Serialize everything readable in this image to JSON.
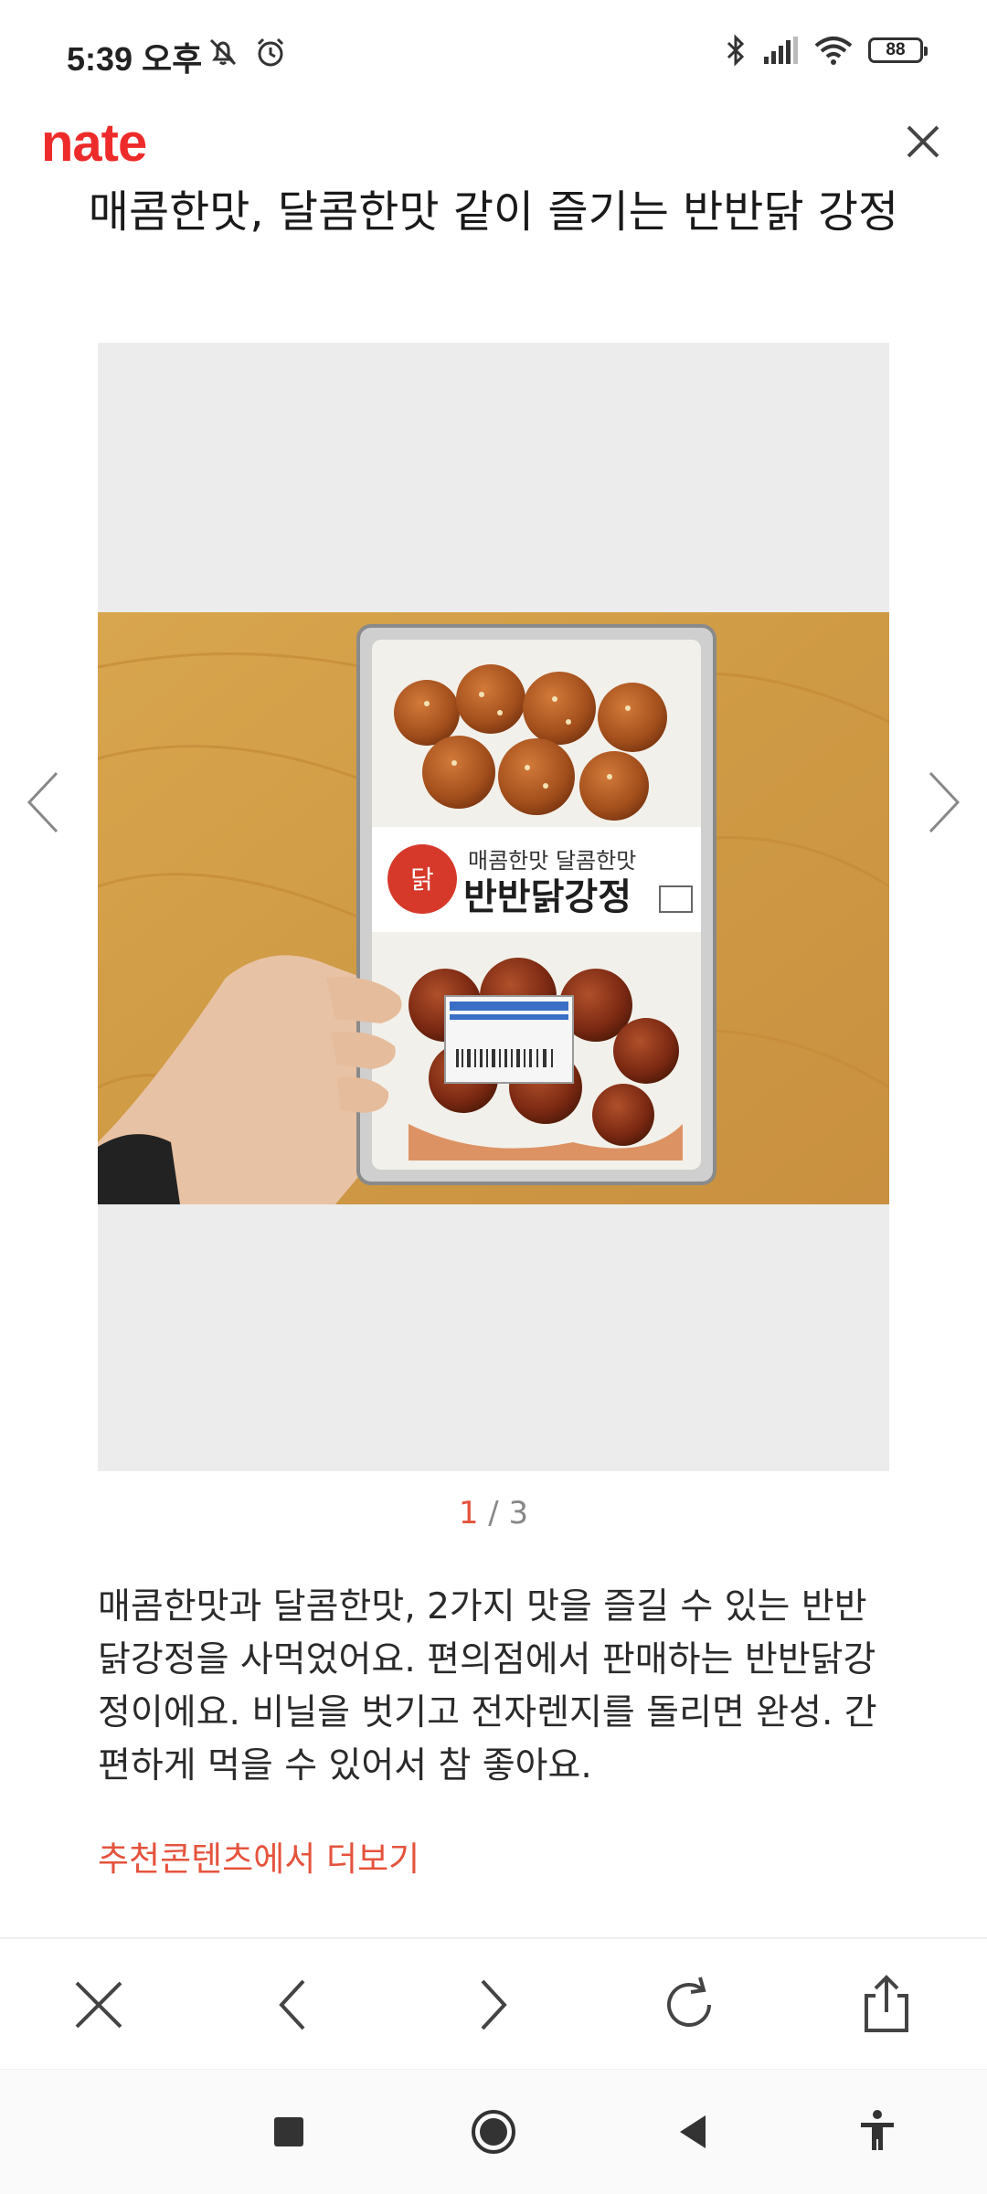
{
  "status_bar": {
    "time": "5:39 오후",
    "battery": "88"
  },
  "header": {
    "logo": "nate"
  },
  "article": {
    "title": "매콤한맛, 달콤한맛 같이 즐기는 반반닭 강정",
    "image": {
      "package_text_top": "매콤한맛 달콤한맛",
      "package_text_main": "반반닭강정"
    },
    "pager": {
      "current": "1",
      "total": "3"
    },
    "body": "매콤한맛과 달콤한맛, 2가지 맛을 즐길 수 있는 반반닭강정을 사먹었어요. 편의점에서 판매하는 반반닭강정이에요. 비닐을 벗기고 전자렌지를 돌리면 완성. 간편하게 먹을 수 있어서 참 좋아요.",
    "more_link": "추천콘텐츠에서 더보기"
  },
  "colors": {
    "brand": "#ee2b2b",
    "accent": "#e5533d",
    "gallery_bg": "#ececec"
  }
}
